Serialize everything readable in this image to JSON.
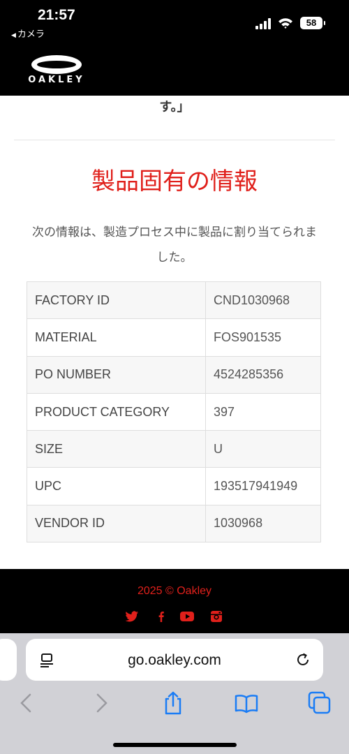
{
  "status": {
    "time": "21:57",
    "back_label": "カメラ",
    "battery": "58"
  },
  "header": {
    "logo_text": "OAKLEY"
  },
  "main": {
    "prev_text": "す。」",
    "section_title": "製品固有の情報",
    "description": "次の情報は、製造プロセス中に製品に割り当てられました。",
    "rows": [
      {
        "label": "FACTORY ID",
        "value": "CND1030968"
      },
      {
        "label": "MATERIAL",
        "value": "FOS901535"
      },
      {
        "label": "PO NUMBER",
        "value": "4524285356"
      },
      {
        "label": "PRODUCT CATEGORY",
        "value": "397"
      },
      {
        "label": "SIZE",
        "value": "U"
      },
      {
        "label": "UPC",
        "value": "193517941949"
      },
      {
        "label": "VENDOR ID",
        "value": "1030968"
      }
    ]
  },
  "footer": {
    "copyright": "2025 © Oakley",
    "social_icons": [
      "twitter-icon",
      "facebook-icon",
      "youtube-icon",
      "instagram-icon"
    ]
  },
  "browser": {
    "url": "go.oakley.com"
  },
  "colors": {
    "accent_red": "#e0201b",
    "ios_blue": "#1a7cf5"
  }
}
